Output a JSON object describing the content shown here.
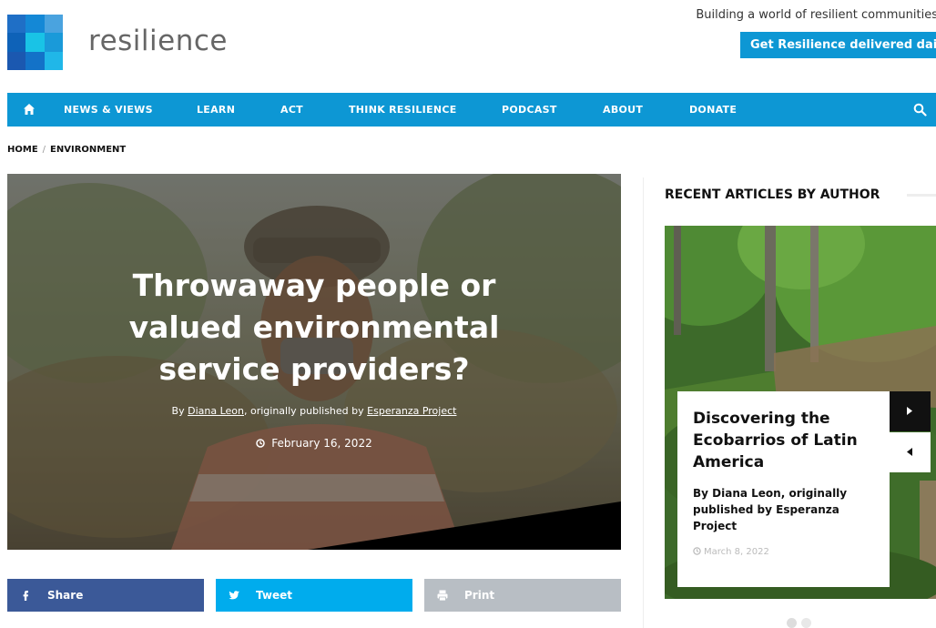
{
  "site": {
    "name": "resilience",
    "tagline": "Building a world of resilient communities",
    "cta_label": "Get Resilience delivered daily"
  },
  "nav": {
    "items": [
      "NEWS & VIEWS",
      "LEARN",
      "ACT",
      "THINK RESILIENCE",
      "PODCAST",
      "ABOUT",
      "DONATE"
    ]
  },
  "breadcrumb": [
    "HOME",
    "ENVIRONMENT"
  ],
  "article": {
    "title": "Throwaway people or valued environmental service providers?",
    "byline_prefix": "By ",
    "author": "Diana Leon",
    "byline_mid": ", originally published by ",
    "source": "Esperanza Project",
    "date": "February 16, 2022"
  },
  "share": {
    "share_label": "Share",
    "tweet_label": "Tweet",
    "print_label": "Print"
  },
  "sidebar": {
    "heading": "RECENT ARTICLES BY AUTHOR",
    "card": {
      "title": "Discovering the Ecobarrios of Latin America",
      "byline": "By Diana Leon, originally published by Esperanza Project",
      "date": "March 8, 2022"
    }
  },
  "colors": {
    "brand_blue": "#0d97d4",
    "facebook": "#3b5998",
    "twitter": "#00aced",
    "print": "#b8bec4"
  },
  "icons": [
    "home-icon",
    "search-icon",
    "facebook-icon",
    "twitter-icon",
    "print-icon",
    "clock-icon",
    "arrow-right-icon",
    "arrow-left-icon"
  ]
}
